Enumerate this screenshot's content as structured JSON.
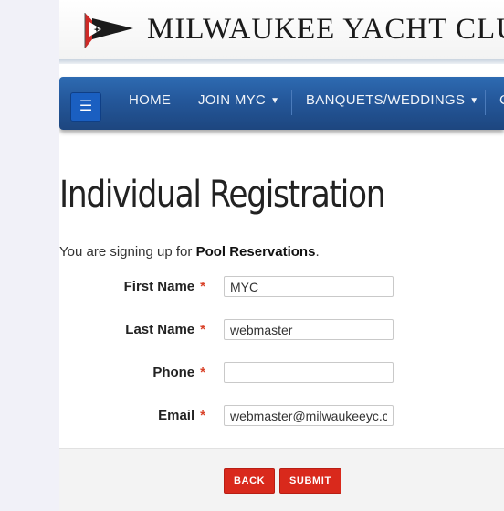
{
  "header": {
    "club_name": "MILWAUKEE YACHT CLUB"
  },
  "nav": {
    "menu_icon": "hamburger-icon",
    "items": [
      {
        "label": "HOME"
      },
      {
        "label": "JOIN MYC"
      },
      {
        "label": "BANQUETS/WEDDINGS"
      },
      {
        "label": "C"
      }
    ]
  },
  "main": {
    "title": "Individual Registration",
    "intro_prefix": "You are signing up for ",
    "intro_event": "Pool Reservations",
    "intro_suffix": "."
  },
  "form": {
    "required_marker": "*",
    "fields": [
      {
        "label": "First Name",
        "value": "MYC"
      },
      {
        "label": "Last Name",
        "value": "webmaster"
      },
      {
        "label": "Phone",
        "value": ""
      },
      {
        "label": "Email",
        "value": "webmaster@milwaukeeyc.com"
      }
    ],
    "back_label": "BACK",
    "submit_label": "SUBMIT"
  },
  "colors": {
    "nav_blue": "#24579a",
    "button_red": "#d9291c",
    "required_red": "#d9432a"
  }
}
